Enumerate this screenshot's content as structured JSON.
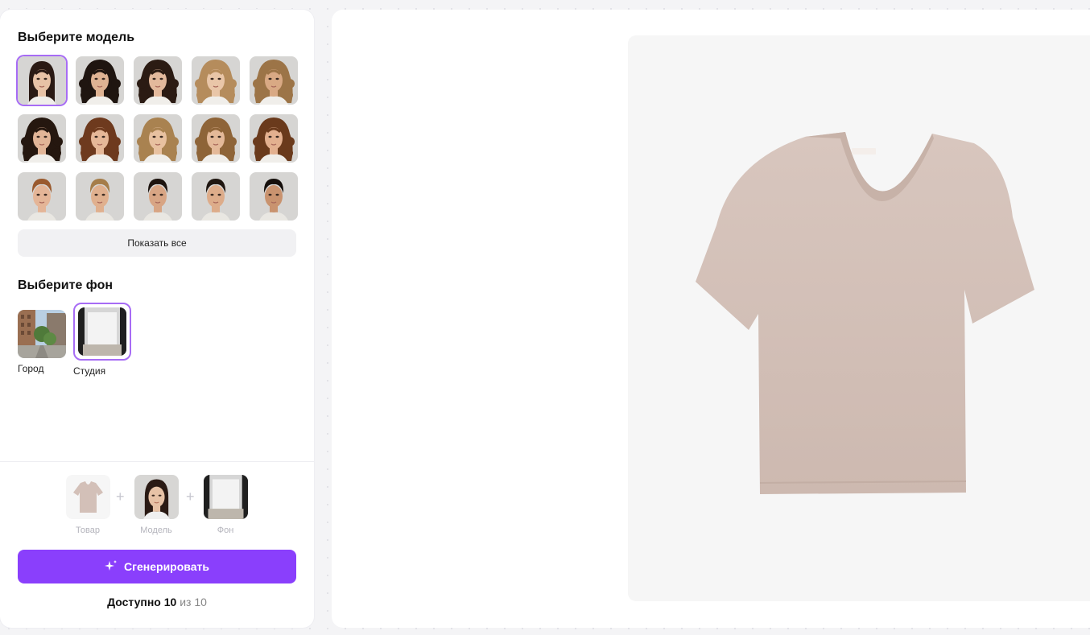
{
  "left_panel": {
    "model_title": "Выберите модель",
    "models": [
      {
        "id": "m1",
        "skin": "#e7c2a6",
        "hair": "#2a1a14",
        "curly": false,
        "male": false,
        "selected": true
      },
      {
        "id": "m2",
        "skin": "#dfb393",
        "hair": "#1f1510",
        "curly": true,
        "male": false,
        "selected": false
      },
      {
        "id": "m3",
        "skin": "#e3b99c",
        "hair": "#2b1b13",
        "curly": true,
        "male": false,
        "selected": false
      },
      {
        "id": "m4",
        "skin": "#e9c6a8",
        "hair": "#b58c5c",
        "curly": true,
        "male": false,
        "selected": false
      },
      {
        "id": "m5",
        "skin": "#d9a984",
        "hair": "#9c7447",
        "curly": true,
        "male": false,
        "selected": false
      },
      {
        "id": "m6",
        "skin": "#e2b597",
        "hair": "#25170f",
        "curly": true,
        "male": false,
        "selected": false
      },
      {
        "id": "m7",
        "skin": "#e6b898",
        "hair": "#6e3a1e",
        "curly": true,
        "male": false,
        "selected": false
      },
      {
        "id": "m8",
        "skin": "#e8c1a0",
        "hair": "#a98250",
        "curly": true,
        "male": false,
        "selected": false
      },
      {
        "id": "m9",
        "skin": "#e4b999",
        "hair": "#8e6438",
        "curly": true,
        "male": false,
        "selected": false
      },
      {
        "id": "m10",
        "skin": "#e3b08f",
        "hair": "#6a3a1c",
        "curly": true,
        "male": false,
        "selected": false
      },
      {
        "id": "m11",
        "skin": "#e4b597",
        "hair": "#9a5a2e",
        "curly": false,
        "male": true,
        "selected": false
      },
      {
        "id": "m12",
        "skin": "#e0b08e",
        "hair": "#a57d4a",
        "curly": false,
        "male": true,
        "selected": false
      },
      {
        "id": "m13",
        "skin": "#d8a584",
        "hair": "#1d140f",
        "curly": false,
        "male": true,
        "selected": false
      },
      {
        "id": "m14",
        "skin": "#ddac8a",
        "hair": "#1f1610",
        "curly": false,
        "male": true,
        "selected": false
      },
      {
        "id": "m15",
        "skin": "#c9936f",
        "hair": "#150f0b",
        "curly": false,
        "male": true,
        "selected": false
      }
    ],
    "show_all_label": "Показать все",
    "background_title": "Выберите фон",
    "backgrounds": [
      {
        "id": "city",
        "label": "Город",
        "selected": false
      },
      {
        "id": "studio",
        "label": "Студия",
        "selected": true
      }
    ],
    "combo": {
      "product_label": "Товар",
      "model_label": "Модель",
      "background_label": "Фон",
      "plus_symbol": "+"
    },
    "generate_label": "Сгенерировать",
    "available": {
      "prefix": "Доступно 10",
      "suffix": "из 10"
    }
  },
  "colors": {
    "accent": "#8a3ffc",
    "selection_border": "#a76cf5",
    "tshirt": "#d3c0b8"
  }
}
